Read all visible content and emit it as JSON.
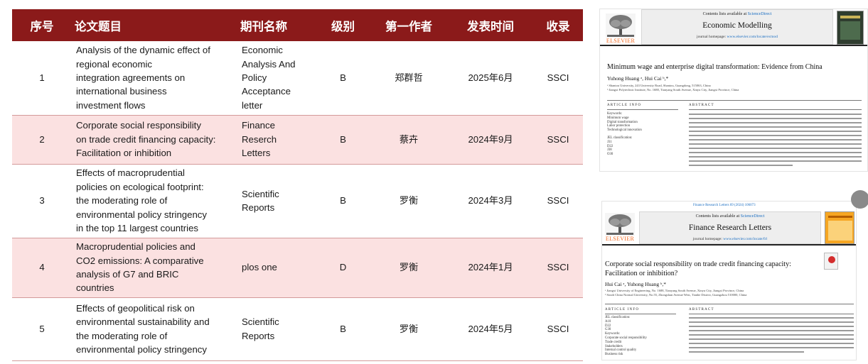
{
  "table": {
    "headers": [
      "序号",
      "论文题目",
      "期刊名称",
      "级别",
      "第一作者",
      "发表时间",
      "收录"
    ],
    "rows": [
      {
        "no": "1",
        "title": [
          "Analysis of the dynamic effect of",
          "regional economic",
          "integration agreements on",
          "international business",
          "investment flows"
        ],
        "journal": [
          "Economic",
          "Analysis And",
          "Policy",
          "Acceptance",
          "letter"
        ],
        "level": "B",
        "author": "郑群哲",
        "date": "2025年6月",
        "index": "SSCI"
      },
      {
        "no": "2",
        "title": [
          "Corporate social responsibility",
          "on trade credit financing capacity:",
          "Facilitation or inhibition"
        ],
        "journal": [
          "Finance",
          "Reserch",
          "Letters"
        ],
        "level": "B",
        "author": "蔡卉",
        "date": "2024年9月",
        "index": "SSCI"
      },
      {
        "no": "3",
        "title": [
          "Effects of macroprudential",
          "policies on ecological footprint:",
          "the moderating role of",
          "environmental policy stringency",
          "in the top 11 largest countries"
        ],
        "journal": [
          "Scientific",
          "Reports"
        ],
        "level": "B",
        "author": "罗衡",
        "date": "2024年3月",
        "index": "SSCI"
      },
      {
        "no": "4",
        "title": [
          "Macroprudential policies and",
          "CO2 emissions: A comparative",
          "analysis of G7 and BRIC",
          "countries"
        ],
        "journal": [
          "plos one"
        ],
        "level": "D",
        "author": "罗衡",
        "date": "2024年1月",
        "index": "SSCI"
      },
      {
        "no": "5",
        "title": [
          "Effects of geopolitical risk on",
          "environmental sustainability and",
          "the moderating role of",
          "environmental policy stringency"
        ],
        "journal": [
          "Scientific",
          "Reports"
        ],
        "level": "B",
        "author": "罗衡",
        "date": "2024年5月",
        "index": "SSCI"
      }
    ]
  },
  "paper1": {
    "contents_prefix": "Contents lists available at ",
    "sciencedirect": "ScienceDirect",
    "journal": "Economic Modelling",
    "homepage_prefix": "journal homepage: ",
    "homepage_url": "www.elsevier.com/locate/ecmod",
    "publisher": "ELSEVIER",
    "title": "Minimum wage and enterprise digital transformation: Evidence from China",
    "authors": "Yuhong Huang ᵃ, Hui Cai ᵇ,*",
    "affiliations": [
      "ᵃ Shantou University, 243 University Road, Shantou, Guangdong, 515063, China",
      "ᵇ Jiangxi Polytechnic Institute, No. 1688, Tianyang South Avenue, Xinyu City, Jiangxi Province, China"
    ],
    "article_info": "ARTICLE INFO",
    "abstract_head": "ABSTRACT",
    "keywords": [
      "Keywords:",
      "Minimum wage",
      "Digital transformation",
      "Labor protection",
      "Technological innovation",
      "",
      "JEL classification:",
      "J31",
      "D22",
      "J38",
      "O30"
    ]
  },
  "paper2": {
    "citation": "Finance Research Letters 69 (2024) 106073",
    "contents_prefix": "Contents lists available at ",
    "sciencedirect": "ScienceDirect",
    "journal": "Finance Research Letters",
    "homepage_prefix": "journal homepage: ",
    "homepage_url": "www.elsevier.com/locate/frl",
    "publisher": "ELSEVIER",
    "title": [
      "Corporate social responsibility on trade credit financing capacity:",
      "Facilitation or inhibition?"
    ],
    "authors": "Hui Cai ᵃ, Yuhong Huang ᵇ,*",
    "affiliations": [
      "ᵃ Jiangxi University of Engineering, No. 1688, Tianyang South Avenue, Xinyu City, Jiangxi Province, China",
      "ᵇ South China Normal University, No.55, Zhongshan Avenue West, Tianhe District, Guangzhou 510000, China"
    ],
    "article_info": "ARTICLE INFO",
    "abstract_head": "ABSTRACT",
    "keywords": [
      "JEL classification:",
      "A10",
      "D22",
      "G30",
      "Keywords:",
      "Corporate social responsibility",
      "Trade credit",
      "Stakeholders",
      "Internal control quality",
      "Business risk"
    ]
  },
  "colors": {
    "header_bg": "#8b1a1a",
    "alt_row": "#fbe1e1",
    "elsevier_orange": "#f26a21",
    "link_blue": "#1b6ec2"
  }
}
